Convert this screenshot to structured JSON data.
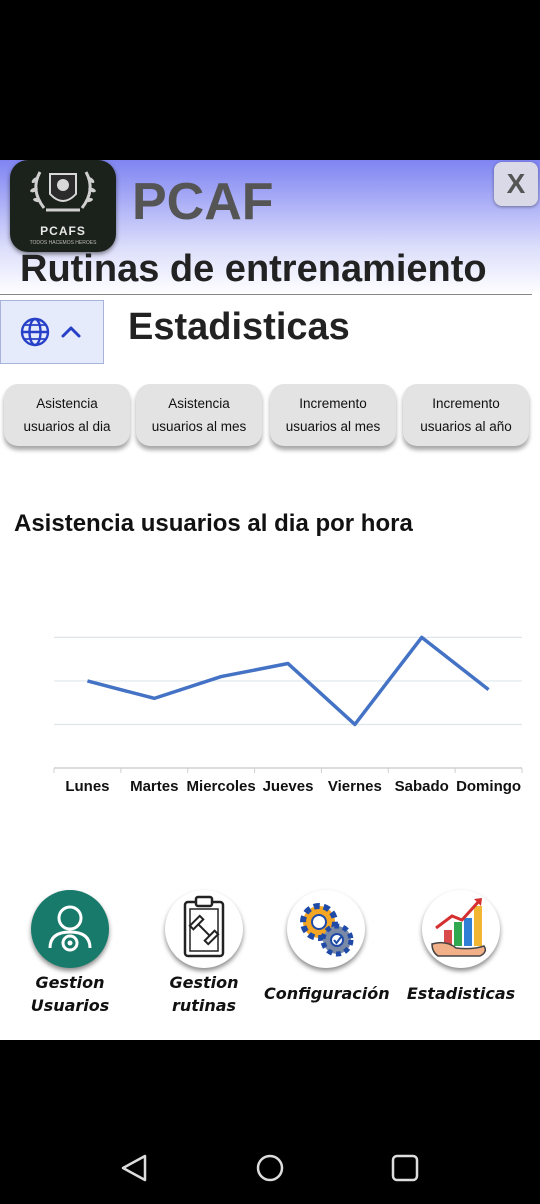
{
  "header": {
    "logo_text": "PCAFS",
    "logo_subtext": "TODOS HACEMOS HEROES",
    "app_title": "PCAF",
    "close_label": "X",
    "page_title": "Rutinas de entrenamiento",
    "section_title": "Estadisticas"
  },
  "tabs": [
    {
      "line1": "Asistencia",
      "line2": "usuarios al dia"
    },
    {
      "line1": "Asistencia",
      "line2": "usuarios al mes"
    },
    {
      "line1": "Incremento",
      "line2": "usuarios al mes"
    },
    {
      "line1": "Incremento",
      "line2": "usuarios al año"
    }
  ],
  "chart_data": {
    "type": "line",
    "title": "Asistencia usuarios al dia por hora",
    "categories": [
      "Lunes",
      "Martes",
      "Miercoles",
      "Jueves",
      "Viernes",
      "Sabado",
      "Domingo"
    ],
    "series": [
      {
        "values": [
          2.0,
          1.6,
          2.1,
          2.4,
          1.0,
          3.0,
          1.8
        ],
        "color": "#4472c4"
      }
    ],
    "ylim": [
      0,
      3.4
    ],
    "gridlines": [
      1,
      2,
      3
    ],
    "grid": true,
    "legend": "none"
  },
  "bottom_nav": [
    {
      "label_line1": "Gestion",
      "label_line2": "Usuarios",
      "icon": "user-gear-icon"
    },
    {
      "label_line1": "Gestion",
      "label_line2": "rutinas",
      "icon": "clipboard-dumbbell-icon"
    },
    {
      "label_line1": "Configuración",
      "label_line2": "",
      "icon": "gears-icon"
    },
    {
      "label_line1": "Estadisticas",
      "label_line2": "",
      "icon": "growth-chart-icon"
    }
  ],
  "colors": {
    "header_gradient_top": "#7f84f2",
    "line_series": "#4472c4",
    "user_circle": "#177a6a"
  }
}
